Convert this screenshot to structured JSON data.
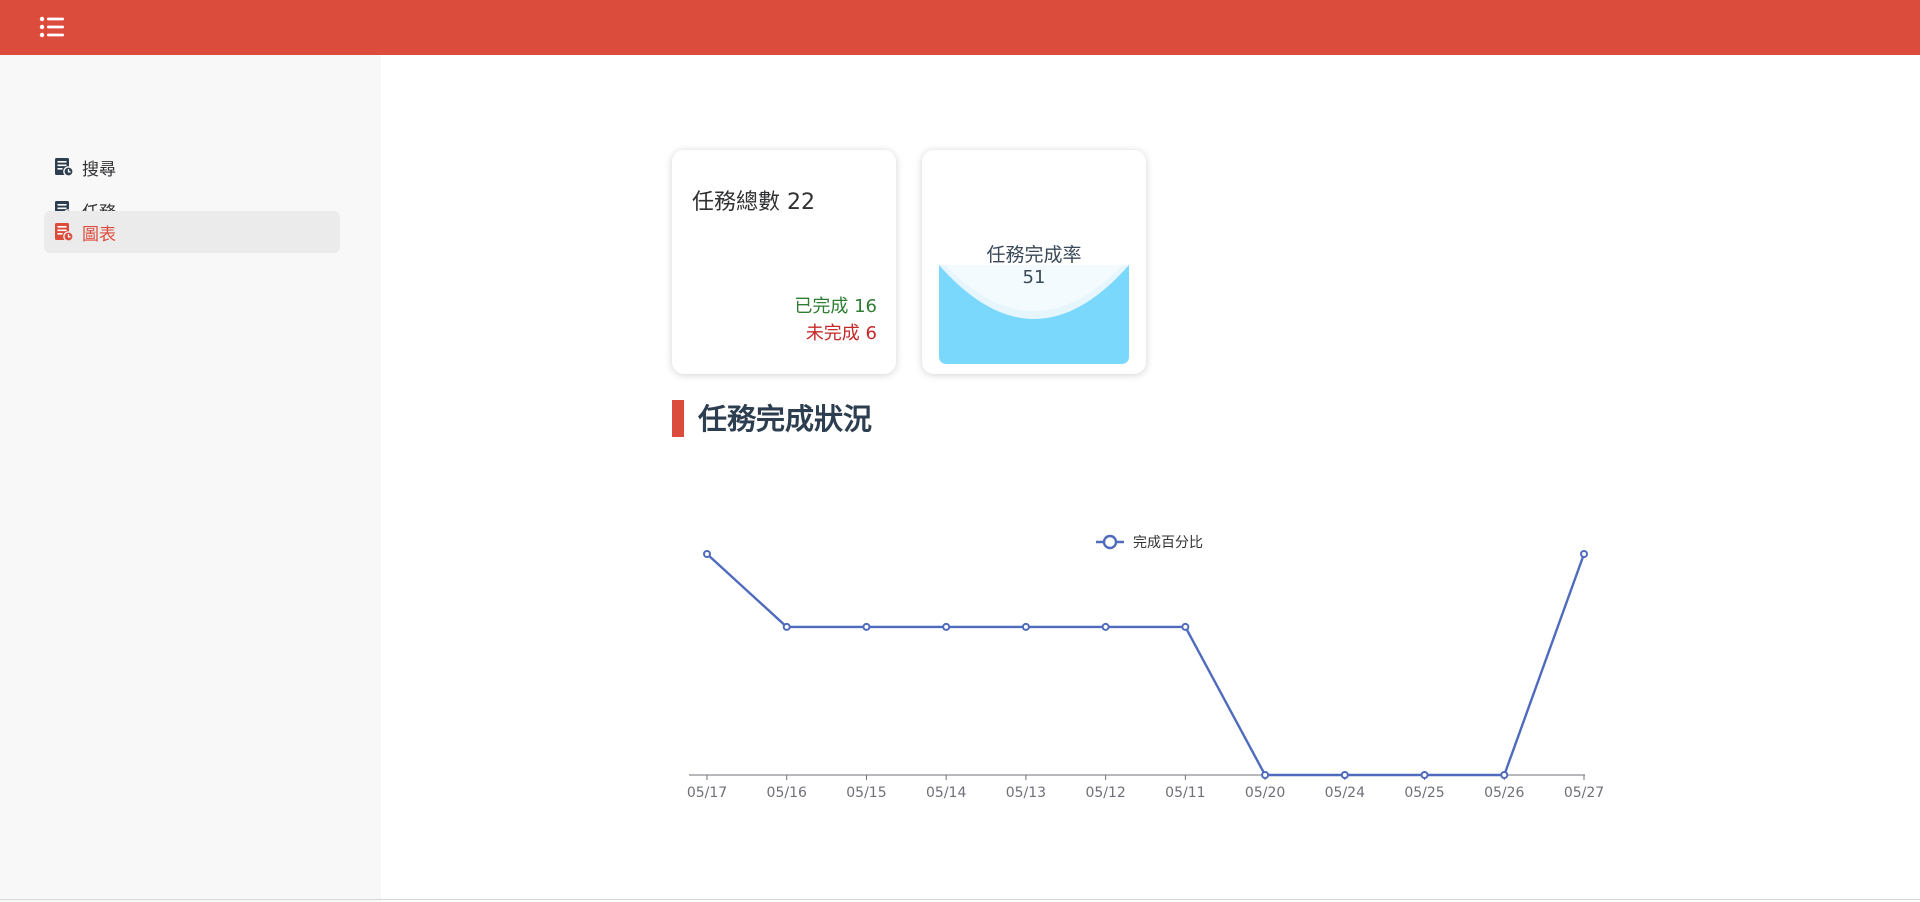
{
  "topbar": {
    "color": "#dc4c3d",
    "menu_icon": "list-menu-icon"
  },
  "sidebar": {
    "items": [
      {
        "label": "搜尋",
        "icon": "document-clock-icon",
        "active": false
      },
      {
        "label": "任務",
        "icon": "document-clock-icon",
        "active": false
      },
      {
        "label": "圖表",
        "icon": "document-clock-icon",
        "active": true
      }
    ]
  },
  "cards": {
    "total": {
      "label": "任務總數",
      "value": "22"
    },
    "done": {
      "label": "已完成",
      "value": "16",
      "color": "#2e7d32"
    },
    "undone": {
      "label": "未完成",
      "value": "6",
      "color": "#c62828"
    },
    "completion": {
      "label": "任務完成率",
      "value": "51",
      "fill_color": "#7ad8fd"
    }
  },
  "section": {
    "title": "任務完成狀況"
  },
  "chart_data": {
    "type": "line",
    "categories": [
      "05/17",
      "05/16",
      "05/15",
      "05/14",
      "05/13",
      "05/12",
      "05/11",
      "05/20",
      "05/24",
      "05/25",
      "05/26",
      "05/27"
    ],
    "series": [
      {
        "name": "完成百分比",
        "values": [
          100,
          67,
          67,
          67,
          67,
          67,
          67,
          0,
          0,
          0,
          0,
          100
        ],
        "color": "#4f6bbd"
      }
    ],
    "ylim": [
      0,
      100
    ],
    "grid": false,
    "legend": "top-center",
    "title": "",
    "xlabel": "",
    "ylabel": ""
  }
}
